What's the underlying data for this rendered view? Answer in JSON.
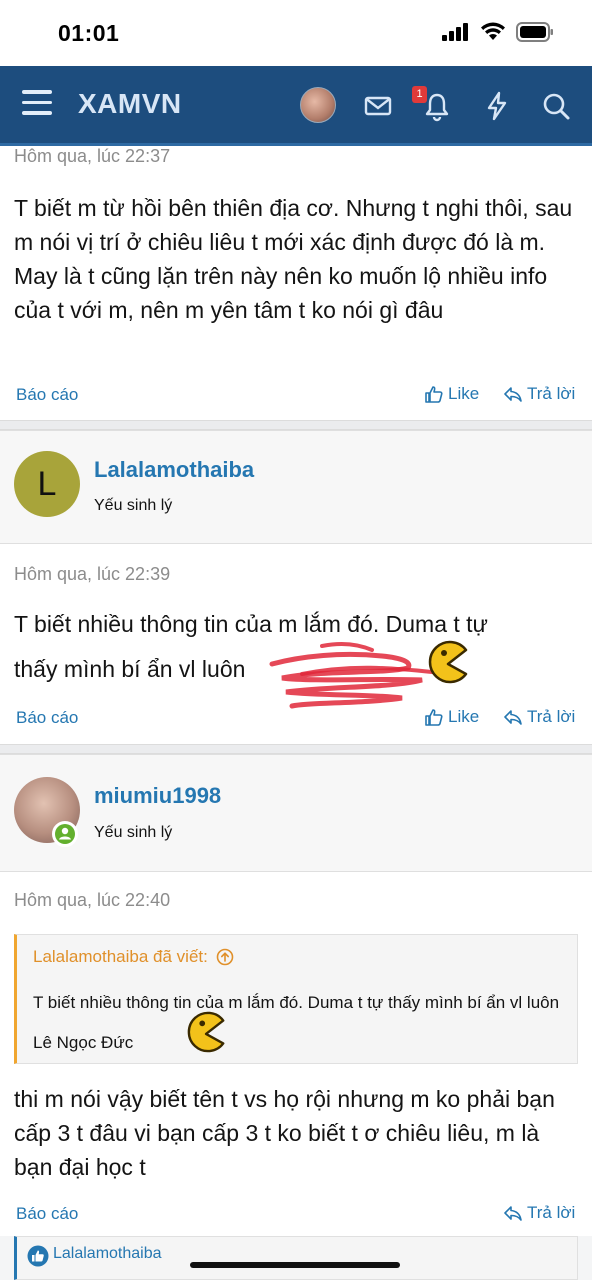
{
  "status_bar": {
    "time": "01:01"
  },
  "header": {
    "logo": "XAMVN",
    "notification_count": "1",
    "colors": {
      "bar": "#1d4d7e",
      "link": "#2577b1",
      "quote_accent": "#f0a630"
    }
  },
  "posts": [
    {
      "date": "Hôm qua, lúc 22:37",
      "text": "T biết m từ hồi bên thiên địa cơ. Nhưng t nghi thôi, sau m nói vị trí ở chiêu liêu t mới xác định được đó là m. May là t cũng lặn trên này nên ko muốn lộ nhiều info của t với m, nên m yên tâm t ko nói gì đâu",
      "report": "Báo cáo",
      "like": "Like",
      "reply": "Trả lời"
    },
    {
      "author": "Lalalamothaiba",
      "avatar_letter": "L",
      "user_title": "Yếu sinh lý",
      "date": "Hôm qua, lúc 22:39",
      "text_line1": "T biết nhiều thông tin của m lắm đó. Duma t tự",
      "text_line2": "thấy mình bí ẩn vl luôn",
      "report": "Báo cáo",
      "like": "Like",
      "reply": "Trả lời"
    },
    {
      "author": "miumiu1998",
      "user_title": "Yếu sinh lý",
      "date": "Hôm qua, lúc 22:40",
      "quote_author": "Lalalamothaiba đã viết:",
      "quote_text": "T biết nhiều thông tin của m lắm đó. Duma t tự thấy mình bí ẩn vl luôn Lê Ngọc Đức",
      "text": "thi m nói vậy biết tên t vs họ rội nhưng m ko phải bạn cấp 3 t đâu vi bạn cấp 3 t ko biết t ơ chiêu liêu, m là bạn đại học t",
      "report": "Báo cáo",
      "reply": "Trả lời"
    }
  ],
  "reaction_bar": {
    "name": "Lalalamothaiba"
  }
}
